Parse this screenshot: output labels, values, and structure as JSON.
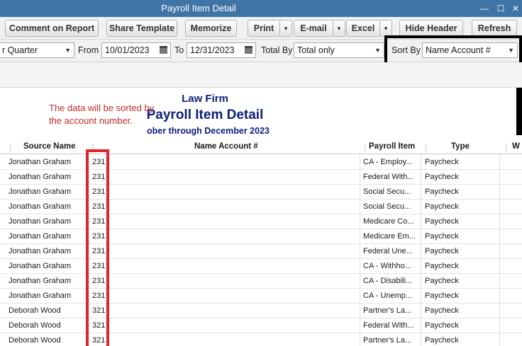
{
  "window": {
    "title": "Payroll Item Detail",
    "controls": [
      "—",
      "☐",
      "✕"
    ]
  },
  "toolbar": {
    "comment": "Comment on Report",
    "share": "Share Template",
    "memorize": "Memorize",
    "print": "Print",
    "email": "E-mail",
    "excel": "Excel",
    "hide_header": "Hide Header",
    "refresh": "Refresh",
    "caret": "▾"
  },
  "filters": {
    "dates_value": "r Quarter",
    "from_label": "From",
    "from_value": "10/01/2023",
    "to_label": "To",
    "to_value": "12/31/2023",
    "total_by_label": "Total By",
    "total_by_value": "Total only",
    "sort_by_label": "Sort By",
    "sort_by_value": "Name Account #",
    "arrow": "▼"
  },
  "report": {
    "company": "Law Firm",
    "title": "Payroll Item Detail",
    "subtitle": "ober through December 2023"
  },
  "annotation": "The data will be sorted by the account number.",
  "columns": {
    "source_name": "Source Name",
    "name_account": "Name Account #",
    "payroll_item": "Payroll Item",
    "type": "Type",
    "extra": "W",
    "dots": "⋮"
  },
  "rows": [
    {
      "source": "Jonathan Graham",
      "account": "231",
      "item": "CA - Employ...",
      "type": "Paycheck"
    },
    {
      "source": "Jonathan Graham",
      "account": "231",
      "item": "Federal With...",
      "type": "Paycheck"
    },
    {
      "source": "Jonathan Graham",
      "account": "231",
      "item": "Social Secu...",
      "type": "Paycheck"
    },
    {
      "source": "Jonathan Graham",
      "account": "231",
      "item": "Social Secu...",
      "type": "Paycheck"
    },
    {
      "source": "Jonathan Graham",
      "account": "231",
      "item": "Medicare Co...",
      "type": "Paycheck"
    },
    {
      "source": "Jonathan Graham",
      "account": "231",
      "item": "Medicare Em...",
      "type": "Paycheck"
    },
    {
      "source": "Jonathan Graham",
      "account": "231",
      "item": "Federal Une...",
      "type": "Paycheck"
    },
    {
      "source": "Jonathan Graham",
      "account": "231",
      "item": "CA - Withho...",
      "type": "Paycheck"
    },
    {
      "source": "Jonathan Graham",
      "account": "231",
      "item": "CA - Disabili...",
      "type": "Paycheck"
    },
    {
      "source": "Jonathan Graham",
      "account": "231",
      "item": "CA - Unemp...",
      "type": "Paycheck"
    },
    {
      "source": "Deborah Wood",
      "account": "321",
      "item": "Partner's La...",
      "type": "Paycheck"
    },
    {
      "source": "Deborah Wood",
      "account": "321",
      "item": "Federal With...",
      "type": "Paycheck"
    },
    {
      "source": "Deborah Wood",
      "account": "321",
      "item": "Partner's La...",
      "type": "Paycheck"
    }
  ],
  "colors": {
    "titlebar": "#3f75a6",
    "report_title": "#0c1f7a",
    "annotation": "#c62828",
    "highlight": "#e0242b"
  }
}
